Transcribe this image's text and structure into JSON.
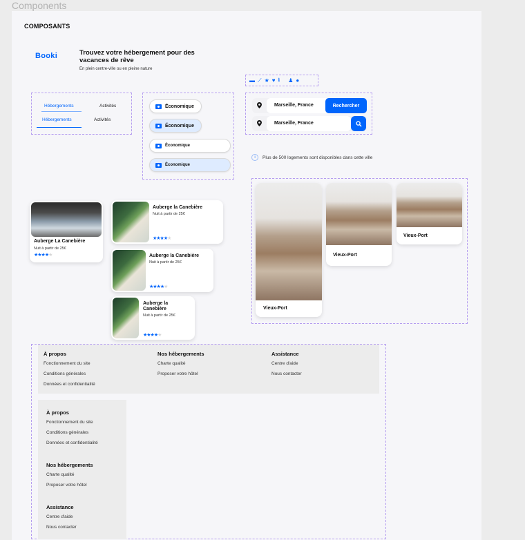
{
  "frame_label": "Components",
  "heading": "COMPOSANTS",
  "header": {
    "logo": "Booki",
    "title": "Trouvez votre hébergement pour des vacances de rêve",
    "subtitle": "En plein centre-ville ou en pleine nature"
  },
  "tabs": {
    "row1": [
      "Hébergements",
      "Activités"
    ],
    "row2": [
      "Hébergements",
      "Activités"
    ]
  },
  "chips": [
    "Économique",
    "Économique",
    "Économique",
    "Économique"
  ],
  "icons_row": [
    "money-icon",
    "chart-icon",
    "star-icon",
    "heart-icon",
    "info-icon",
    "person-icon",
    "fire-icon"
  ],
  "search": {
    "value1": "Marseille, France",
    "button": "Rechercher",
    "value2": "Marseille, France"
  },
  "info_text": "Plus de 500 logements sont disponibles dans cette ville",
  "cards": [
    {
      "title": "Auberge La Canebière",
      "price": "Nuit à partir de 25€",
      "rating": 4
    },
    {
      "title": "Auberge la Canebière",
      "price": "Nuit à partir de 25€",
      "rating": 4
    },
    {
      "title": "Auberge la Canebière",
      "price": "Nuit à partir de 25€",
      "rating": 4
    },
    {
      "title": "Auberge la Canebière",
      "price": "Nuit à partir de 25€",
      "rating": 4
    }
  ],
  "places": [
    "Vieux-Port",
    "Vieux-Port",
    "Vieux-Port"
  ],
  "footer": {
    "col1": {
      "title": "À propos",
      "links": [
        "Fonctionnement du site",
        "Conditions générales",
        "Données et confidentialité"
      ]
    },
    "col2": {
      "title": "Nos hébergements",
      "links": [
        "Charte qualité",
        "Proposer votre hôtel"
      ]
    },
    "col3": {
      "title": "Assistance",
      "links": [
        "Centre d'aide",
        "Nous contacter"
      ]
    }
  },
  "colors": {
    "accent": "#0065fc",
    "chip_selected": "#deebff",
    "dash": "#b59df0"
  }
}
